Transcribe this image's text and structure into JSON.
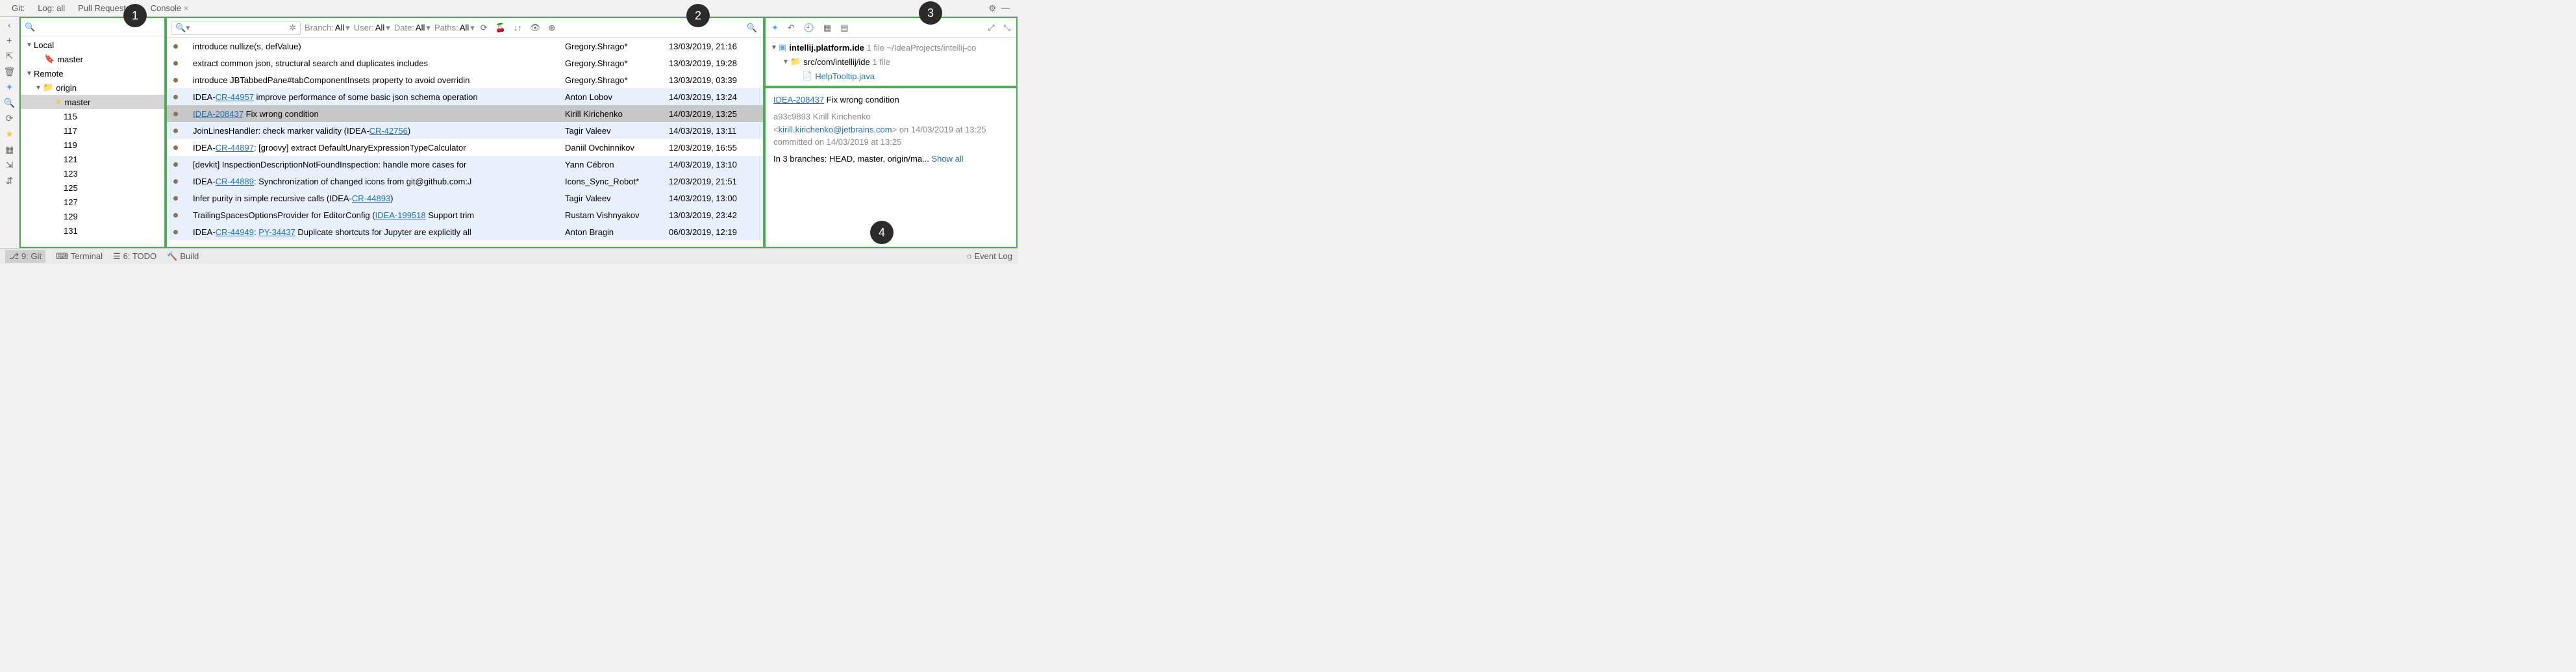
{
  "top_tabs": {
    "git_label": "Git:",
    "log_label": "Log: all",
    "pull_label": "Pull Requests",
    "console_label": "Console"
  },
  "pane1": {
    "local_label": "Local",
    "master_label": "master",
    "remote_label": "Remote",
    "origin_label": "origin",
    "origin_master_label": "master",
    "numeric_branches": [
      "115",
      "117",
      "119",
      "121",
      "123",
      "125",
      "127",
      "129",
      "131"
    ]
  },
  "pane2": {
    "filters": {
      "branch_label": "Branch:",
      "branch_value": "All",
      "user_label": "User:",
      "user_value": "All",
      "date_label": "Date:",
      "date_value": "All",
      "paths_label": "Paths:",
      "paths_value": "All"
    },
    "commits": [
      {
        "hl": false,
        "prefix": "",
        "link": "",
        "rest": "introduce nullize(s, defValue)",
        "author": "Gregory.Shrago*",
        "date": "13/03/2019, 21:16"
      },
      {
        "hl": false,
        "prefix": "",
        "link": "",
        "rest": "extract common json, structural search and duplicates includes",
        "author": "Gregory.Shrago*",
        "date": "13/03/2019, 19:28"
      },
      {
        "hl": false,
        "prefix": "",
        "link": "",
        "rest": "introduce JBTabbedPane#tabComponentInsets property to avoid overridin",
        "author": "Gregory.Shrago*",
        "date": "13/03/2019, 03:39"
      },
      {
        "hl": true,
        "prefix": "IDEA-",
        "link": "CR-44957",
        "rest": " improve performance of some basic json schema operation",
        "author": "Anton Lobov",
        "date": "14/03/2019, 13:24"
      },
      {
        "hl": false,
        "sel": true,
        "prefix": "",
        "link": "IDEA-208437",
        "rest": " Fix wrong condition",
        "author": "Kirill Kirichenko",
        "date": "14/03/2019, 13:25"
      },
      {
        "hl": true,
        "prefix": "",
        "link": "",
        "rest": "JoinLinesHandler: check marker validity (IDEA-",
        "tail_link": "CR-42756",
        "tail": ")",
        "author": "Tagir Valeev",
        "date": "14/03/2019, 13:11"
      },
      {
        "hl": false,
        "prefix": "IDEA-",
        "link": "CR-44897",
        "rest": ": [groovy] extract DefaultUnaryExpressionTypeCalculator",
        "author": "Daniil Ovchinnikov",
        "date": "12/03/2019, 16:55"
      },
      {
        "hl": true,
        "prefix": "",
        "link": "",
        "rest": "[devkit] InspectionDescriptionNotFoundInspection: handle more cases for ",
        "author": "Yann Cébron",
        "date": "14/03/2019, 13:10"
      },
      {
        "hl": true,
        "prefix": "IDEA-",
        "link": "CR-44889",
        "rest": ": Synchronization of changed icons from git@github.com:J",
        "author": "Icons_Sync_Robot*",
        "date": "12/03/2019, 21:51"
      },
      {
        "hl": true,
        "prefix": "",
        "link": "",
        "rest": "Infer purity in simple recursive calls (IDEA-",
        "tail_link": "CR-44893",
        "tail": ")",
        "author": "Tagir Valeev",
        "date": "14/03/2019, 13:00"
      },
      {
        "hl": true,
        "prefix": "",
        "link": "",
        "rest": "TrailingSpacesOptionsProvider for EditorConfig (",
        "tail_link": "IDEA-199518",
        "tail": " Support trim",
        "author": "Rustam Vishnyakov",
        "date": "13/03/2019, 23:42"
      },
      {
        "hl": true,
        "prefix": "IDEA-",
        "link": "CR-44949",
        "rest": ": ",
        "link2": "PY-34437",
        "rest2": " Duplicate shortcuts for Jupyter are explicitly all",
        "author": "Anton Bragin",
        "date": "06/03/2019, 12:19"
      }
    ]
  },
  "pane3": {
    "root_label": "intellij.platform.ide",
    "root_count": "1 file",
    "root_path": "~/IdeaProjects/intellij-co",
    "pkg_label": "src/com/intellij/ide",
    "pkg_count": "1 file",
    "file_label": "HelpTooltip.java"
  },
  "pane4": {
    "issue": "IDEA-208437",
    "title_rest": " Fix wrong condition",
    "hash_author": "a93c9893 Kirill Kirichenko",
    "email": "kirill.kirichenko@jetbrains.com",
    "on_date": " on 14/03/2019 at 13:25",
    "committed": "committed on 14/03/2019 at 13:25",
    "branches": "In 3 branches: HEAD, master, origin/ma... ",
    "show_all": "Show all"
  },
  "status_bar": {
    "git": "9: Git",
    "terminal": "Terminal",
    "todo": "6: TODO",
    "build": "Build",
    "event_log": "Event Log"
  },
  "callouts": [
    "1",
    "2",
    "3",
    "4"
  ]
}
